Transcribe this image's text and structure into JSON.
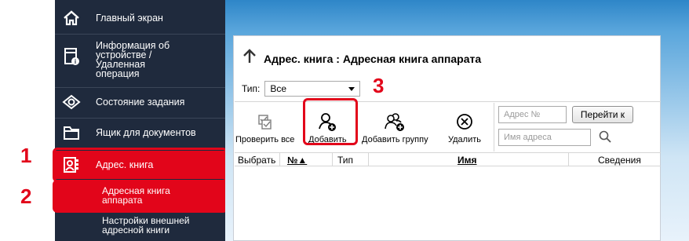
{
  "sidebar": {
    "items": [
      {
        "icon": "home-icon",
        "label": "Главный экран"
      },
      {
        "icon": "device-info-icon",
        "label_lines": [
          "Информация об",
          "устройстве /",
          "Удаленная",
          "операция"
        ]
      },
      {
        "icon": "eye-icon",
        "label": "Состояние задания"
      },
      {
        "icon": "folder-icon",
        "label": "Ящик для документов"
      },
      {
        "icon": "address-book-icon",
        "label": "Адрес. книга"
      }
    ],
    "subitems": [
      {
        "label_lines": [
          "Адресная книга",
          "аппарата"
        ]
      },
      {
        "label_lines": [
          "Настройки внешней",
          "адресной книги"
        ]
      }
    ],
    "active_color": "#e2051a"
  },
  "callouts": {
    "one": "1",
    "two": "2",
    "three": "3"
  },
  "main": {
    "title": "Адрес. книга : Адресная книга аппарата",
    "type_label": "Тип:",
    "type_value": "Все",
    "toolbar": {
      "check_all": "Проверить все",
      "add": "Добавить",
      "add_group": "Добавить группу",
      "delete": "Удалить"
    },
    "address_no_placeholder": "Адрес №",
    "go_button": "Перейти к",
    "name_placeholder": "Имя адреса",
    "columns": {
      "select": "Выбрать",
      "no": "№▲",
      "type": "Тип",
      "name": "Имя",
      "details": "Сведения"
    }
  }
}
